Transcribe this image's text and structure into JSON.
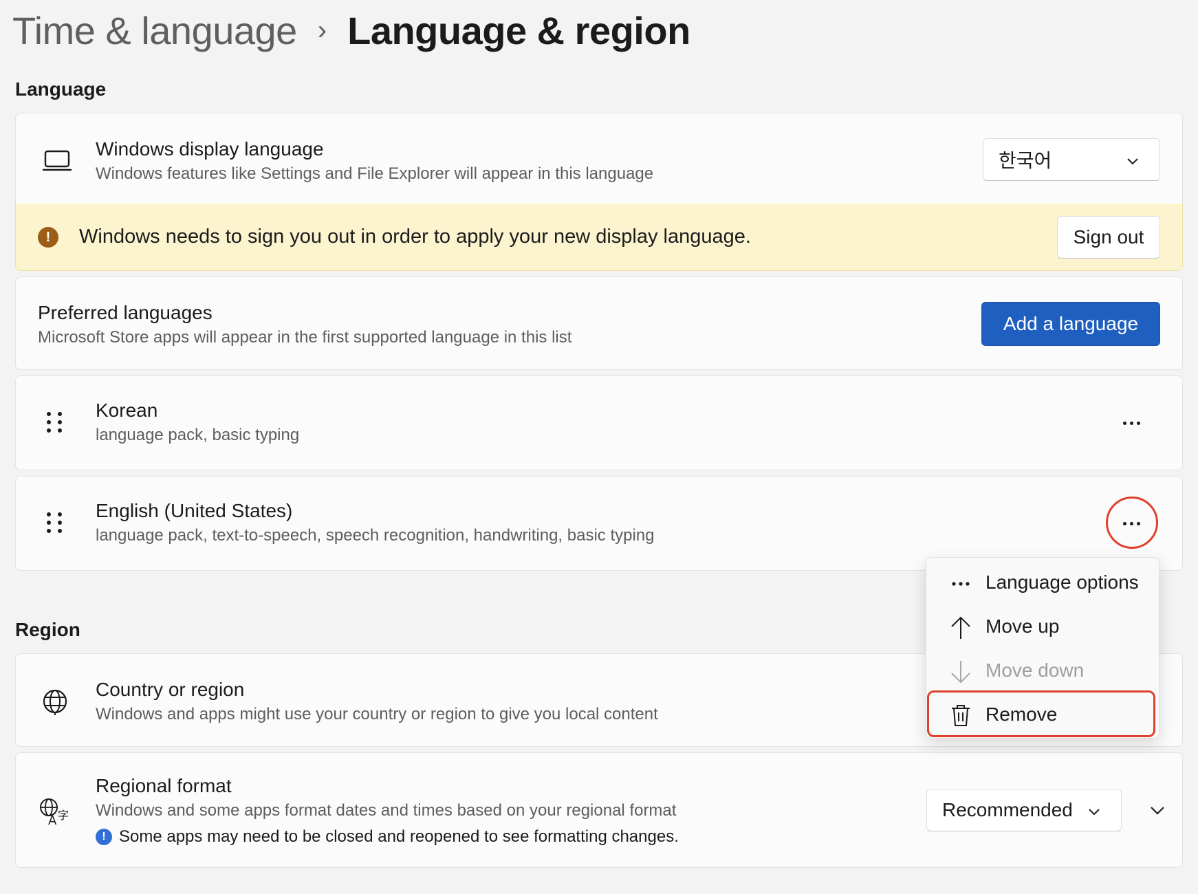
{
  "breadcrumb": {
    "parent": "Time & language",
    "separator": "›",
    "current": "Language & region"
  },
  "language_section": {
    "title": "Language",
    "display_language": {
      "title": "Windows display language",
      "description": "Windows features like Settings and File Explorer will appear in this language",
      "selected": "한국어",
      "icon": "laptop-icon"
    },
    "warning": {
      "icon": "warning-icon",
      "message": "Windows needs to sign you out in order to apply your new display language.",
      "button": "Sign out"
    },
    "preferred": {
      "title": "Preferred languages",
      "description": "Microsoft Store apps will appear in the first supported language in this list",
      "button": "Add a language"
    },
    "languages": [
      {
        "name": "Korean",
        "features": "language pack, basic typing"
      },
      {
        "name": "English (United States)",
        "features": "language pack, text-to-speech, speech recognition, handwriting, basic typing"
      }
    ]
  },
  "context_menu": {
    "items": [
      {
        "label": "Language options",
        "icon": "more-icon",
        "enabled": true
      },
      {
        "label": "Move up",
        "icon": "arrow-up-icon",
        "enabled": true
      },
      {
        "label": "Move down",
        "icon": "arrow-down-icon",
        "enabled": false
      },
      {
        "label": "Remove",
        "icon": "trash-icon",
        "enabled": true
      }
    ]
  },
  "region_section": {
    "title": "Region",
    "country": {
      "title": "Country or region",
      "description": "Windows and apps might use your country or region to give you local content",
      "icon": "globe-icon"
    },
    "regional_format": {
      "title": "Regional format",
      "description": "Windows and some apps format dates and times based on your regional format",
      "note": "Some apps may need to be closed and reopened to see formatting changes.",
      "selected": "Recommended",
      "icon": "language-format-icon"
    }
  },
  "colors": {
    "accent": "#1e5fbf",
    "warning_bg": "#fcf4cf",
    "warning_icon": "#9c5d16",
    "highlight": "#e0402c",
    "info": "#2f6fd6"
  }
}
